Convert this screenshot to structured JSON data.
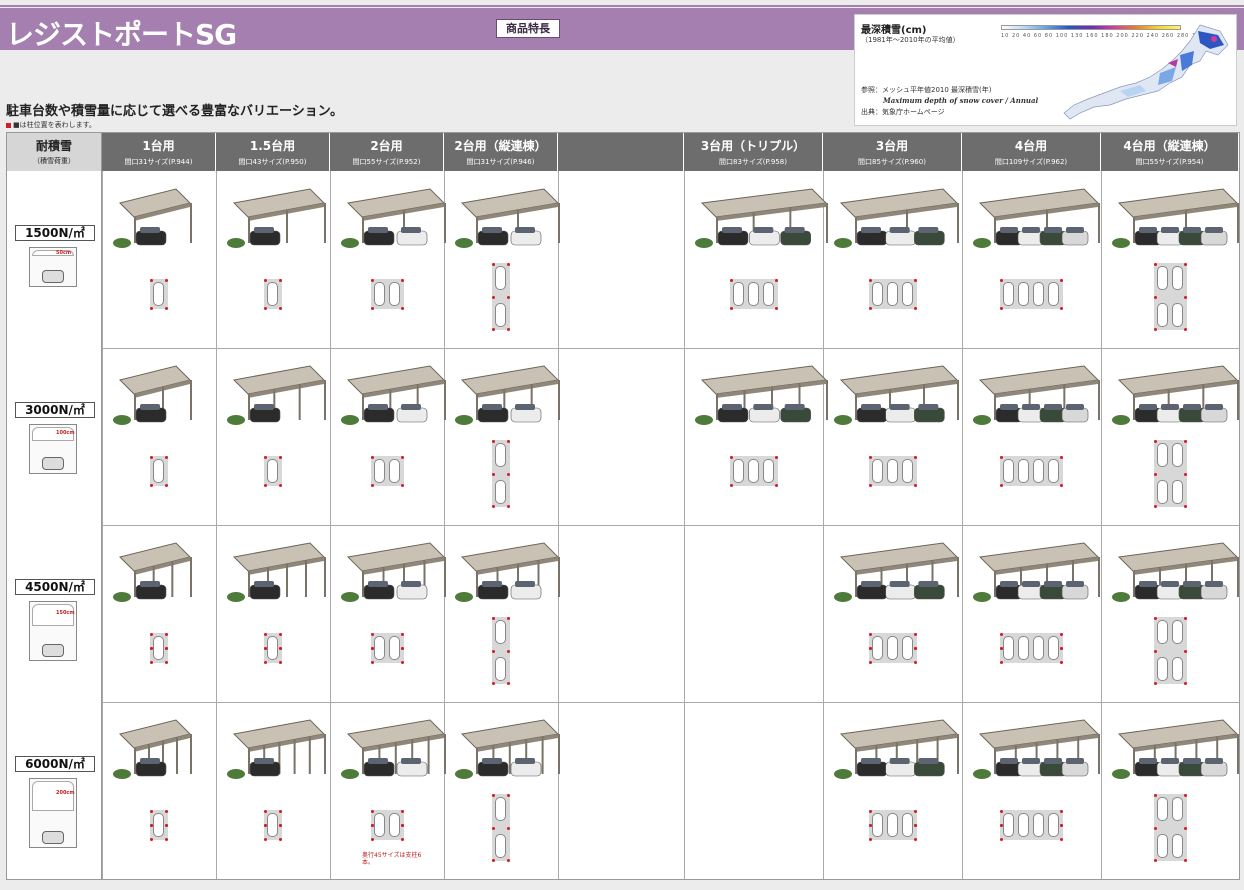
{
  "header": {
    "title": "レジストポートSG",
    "feature_badge": "商品特長",
    "tagline": "駐車台数や積雪量に応じて選べる豊富なバリエーション。",
    "note": "■は柱位置を表わします。"
  },
  "snow_map": {
    "title": "最深積雪(cm)",
    "period": "（1981年〜2010年の平均値）",
    "scale_ticks": "10 20 40 60 80 100 130 160 180 200 220 240 260 280 300 (cm)",
    "reference": "参照：メッシュ平年値2010 最深積雪(年)",
    "english": "Maximum depth of snow cover / Annual",
    "source": "出典：気象庁ホームページ"
  },
  "table": {
    "load_header": "耐積雪",
    "load_subheader": "（積雪荷重）",
    "columns": [
      {
        "title": "1台用",
        "sub": "間口31サイズ(P.944)"
      },
      {
        "title": "1.5台用",
        "sub": "間口43サイズ(P.950)"
      },
      {
        "title": "2台用",
        "sub": "間口55サイズ(P.952)"
      },
      {
        "title": "2台用（縦連棟）",
        "sub": "間口31サイズ(P.946)"
      },
      {
        "title": "",
        "sub": ""
      },
      {
        "title": "3台用（トリプル）",
        "sub": "間口83サイズ(P.958)"
      },
      {
        "title": "3台用",
        "sub": "間口85サイズ(P.960)"
      },
      {
        "title": "4台用",
        "sub": "間口109サイズ(P.962)"
      },
      {
        "title": "4台用（縦連棟）",
        "sub": "間口55サイズ(P.954)"
      }
    ],
    "rows": [
      {
        "load": "1500N/㎡",
        "depth": "50cm"
      },
      {
        "load": "3000N/㎡",
        "depth": "100cm"
      },
      {
        "load": "4500N/㎡",
        "depth": "150cm"
      },
      {
        "load": "6000N/㎡",
        "depth": "200cm"
      }
    ],
    "cell_note": "奥行45サイズは支柱6本。"
  },
  "colors": {
    "header": "#a47fb0",
    "post": "#d21c2c",
    "table_header": "#6d6d6d"
  }
}
